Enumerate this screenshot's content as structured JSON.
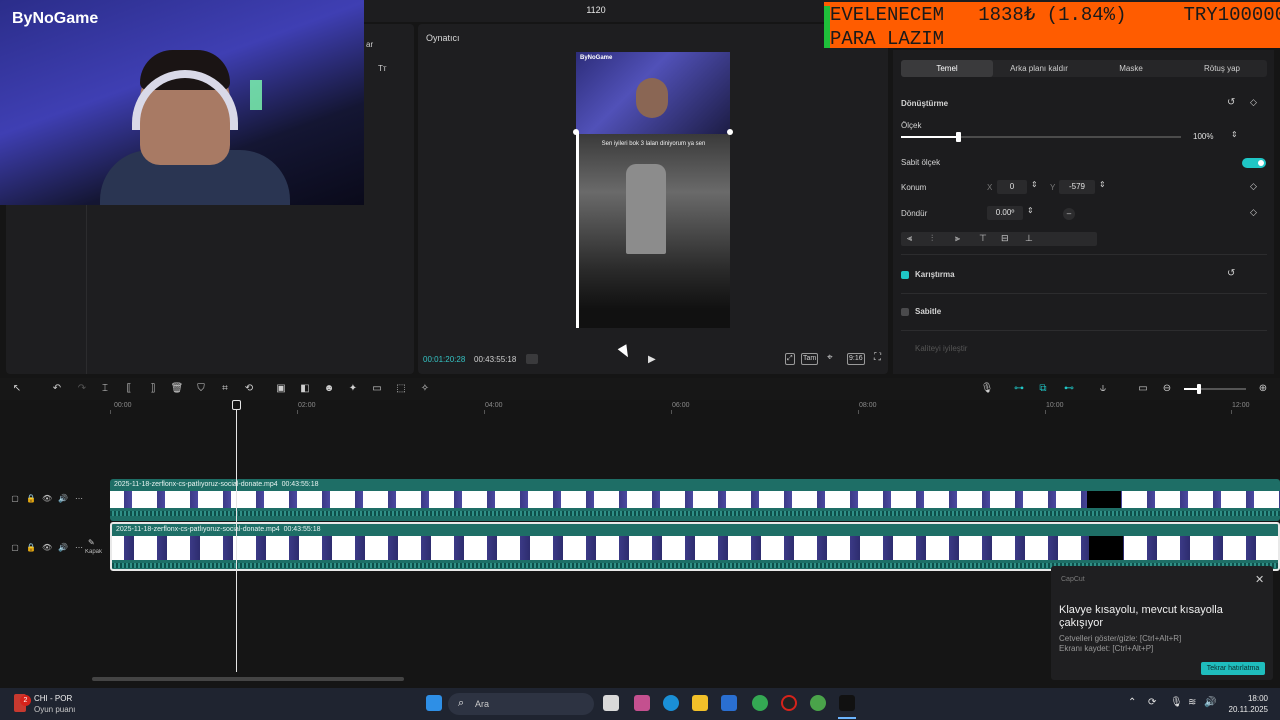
{
  "window": {
    "title": "1120"
  },
  "webcam": {
    "logo": "ByNoGame"
  },
  "ticker": {
    "line1": "EVELENECEM   1838₺ (1.84%)     TRY100000",
    "line2": "PARA LAZIM"
  },
  "left_panel": {
    "partial_label": "ar",
    "partial_icon": "Tᴛ"
  },
  "player": {
    "title": "Oynatıcı",
    "video_brand": "ByNoGame",
    "video_caption": "Sen iyileri bok 3 lalan diniyorum ya sen",
    "time_current": "00:01:20:28",
    "time_total": "00:43:55:18",
    "tools": {
      "full_label": "Tam",
      "ratio_label": "9:16"
    }
  },
  "props": {
    "tabs": [
      "Temel",
      "Arka planı kaldır",
      "Maske",
      "Rötuş yap"
    ],
    "transform_title": "Dönüştürme",
    "scale_label": "Ölçek",
    "scale_value": "100%",
    "scale_fraction": 0.2,
    "uniform_label": "Sabit ölçek",
    "position_label": "Konum",
    "x_label": "X",
    "x_value": "0",
    "y_label": "Y",
    "y_value": "-579",
    "rotate_label": "Döndür",
    "rotate_value": "0.00º",
    "blend_label": "Karıştırma",
    "stabilize_label": "Sabitle",
    "quality_label": "Kaliteyi iyileştir"
  },
  "timeline": {
    "ruler": [
      "00:00",
      "02:00",
      "04:00",
      "06:00",
      "08:00",
      "10:00",
      "12:00"
    ],
    "clips": [
      {
        "name": "2025-11-18-zerflonx-cs-patlıyoruz-social-donate.mp4",
        "duration": "00:43:55:18"
      },
      {
        "name": "2025-11-18-zerflonx-cs-patlıyoruz-social-donate.mp4",
        "duration": "00:43:55:18"
      }
    ],
    "cover_label": "Kapak"
  },
  "notification": {
    "brand": "CapCut",
    "title": "Klavye kısayolu, mevcut kısayolla çakışıyor",
    "line1": "Cetvelleri göster/gizle: [Ctrl+Alt+R]",
    "line2": "Ekranı kaydet: [Ctrl+Alt+P]",
    "button": "Tekrar hatırlatma"
  },
  "taskbar": {
    "weather_badge": "2",
    "weather_title": "CHI - POR",
    "weather_sub": "Oyun puanı",
    "search_placeholder": "Ara",
    "time": "18:00",
    "date": "20.11.2025"
  },
  "colors": {
    "accent": "#1fc6c6",
    "ticker_bg": "#ff5c00",
    "track": "#1e6e66"
  }
}
